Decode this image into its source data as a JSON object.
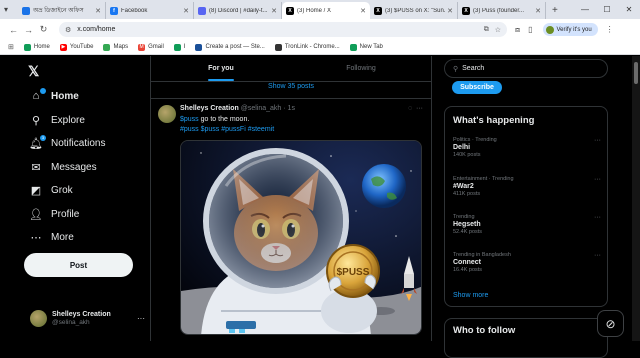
{
  "browser": {
    "tabs": [
      {
        "title": "অভ্র ডিজাইনে অফিস",
        "favicon": "chrome-icon",
        "color": "#1a73e8"
      },
      {
        "title": "Facebook",
        "favicon": "facebook-icon",
        "color": "#1877f2"
      },
      {
        "title": "(8) Discord | #daily-t...",
        "favicon": "discord-icon",
        "color": "#5865f2"
      },
      {
        "title": "(3) Home / X",
        "favicon": "x-icon",
        "color": "#000000",
        "active": true
      },
      {
        "title": "(3) $PUSS on X: \"Sun...",
        "favicon": "x-icon",
        "color": "#000000"
      },
      {
        "title": "(3) Puss (founder...",
        "favicon": "x-icon",
        "color": "#000000"
      }
    ],
    "url": "x.com/home",
    "profile_label": "Verify it's you",
    "bookmarks": [
      {
        "label": "Home",
        "icon": "chrome-icon",
        "color": "#0f9d58"
      },
      {
        "label": "YouTube",
        "icon": "youtube-icon",
        "color": "#ff0000"
      },
      {
        "label": "Maps",
        "icon": "maps-icon",
        "color": "#34a853"
      },
      {
        "label": "Gmail",
        "icon": "gmail-icon",
        "color": "#ea4335"
      },
      {
        "label": "I",
        "icon": "chrome-icon",
        "color": "#0f9d58"
      },
      {
        "label": "Create a post — Ste...",
        "icon": "steemit-icon",
        "color": "#1a5099"
      },
      {
        "label": "TronLink - Chrome...",
        "icon": "tronlink-icon",
        "color": "#333333"
      },
      {
        "label": "New Tab",
        "icon": "chrome-icon",
        "color": "#0f9d58"
      }
    ]
  },
  "sidebar": {
    "items": [
      {
        "label": "Home",
        "icon": "home-icon",
        "active": true
      },
      {
        "label": "Explore",
        "icon": "search-icon"
      },
      {
        "label": "Notifications",
        "icon": "bell-icon",
        "badge": "3"
      },
      {
        "label": "Messages",
        "icon": "mail-icon"
      },
      {
        "label": "Grok",
        "icon": "grok-icon"
      },
      {
        "label": "Profile",
        "icon": "person-icon"
      },
      {
        "label": "More",
        "icon": "more-icon"
      }
    ],
    "post_label": "Post",
    "account": {
      "name": "Shelleys Creation",
      "handle": "@selina_akh"
    }
  },
  "feed": {
    "tabs": [
      "For you",
      "Following"
    ],
    "show_posts": "Show 35 posts",
    "tweet": {
      "name": "Shelleys Creation",
      "handle": "@selina_akh · 1s",
      "cashtag": "$puss",
      "text": " go to the moon.",
      "tags": "#puss $puss #pussFi #steemit",
      "coin_label": "$PUSS"
    }
  },
  "right": {
    "search_placeholder": "Search",
    "subscribe_label": "Subscribe",
    "happening_title": "What's happening",
    "trends": [
      {
        "context": "Politics · Trending",
        "name": "Delhi",
        "count": "140K posts"
      },
      {
        "context": "Entertainment · Trending",
        "name": "#War2",
        "count": "411K posts"
      },
      {
        "context": "Trending",
        "name": "Hegseth",
        "count": "52.4K posts"
      },
      {
        "context": "Trending in Bangladesh",
        "name": "Connect",
        "count": "16.4K posts"
      }
    ],
    "show_more": "Show more",
    "who_to_follow": "Who to follow"
  }
}
